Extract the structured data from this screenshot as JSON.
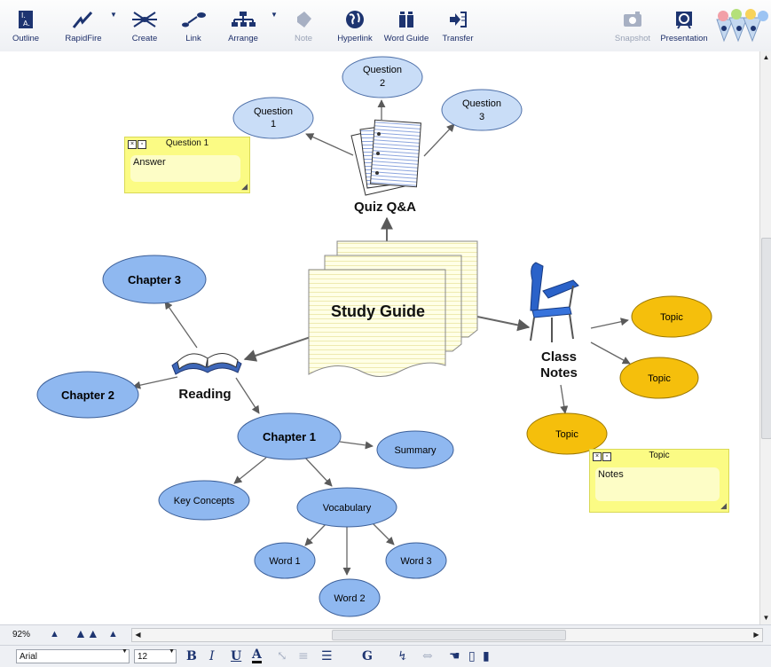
{
  "toolbar": {
    "outline": "Outline",
    "rapidfire": "RapidFire",
    "create": "Create",
    "link": "Link",
    "arrange": "Arrange",
    "note": "Note",
    "hyperlink": "Hyperlink",
    "word_guide": "Word Guide",
    "transfer": "Transfer",
    "snapshot": "Snapshot",
    "presentation": "Presentation"
  },
  "diagram": {
    "study_guide": "Study Guide",
    "quiz": "Quiz Q&A",
    "question1": [
      "Question",
      "1"
    ],
    "question2": [
      "Question",
      "2"
    ],
    "question3": [
      "Question",
      "3"
    ],
    "reading": "Reading",
    "chapter1": "Chapter 1",
    "chapter2": "Chapter 2",
    "chapter3": "Chapter 3",
    "summary": "Summary",
    "key_concepts": "Key Concepts",
    "vocabulary": "Vocabulary",
    "word1": "Word 1",
    "word2": "Word 2",
    "word3": "Word 3",
    "class_notes": [
      "Class",
      "Notes"
    ],
    "topic1": "Topic",
    "topic2": "Topic",
    "topic3": "Topic"
  },
  "notes": {
    "q1_title": "Question 1",
    "q1_body": "Answer",
    "topic_title": "Topic",
    "topic_body": "Notes"
  },
  "zoom": "92%",
  "format": {
    "font": "Arial",
    "size": "12",
    "bold": "B",
    "italic": "I",
    "underline": "U",
    "color": "A"
  },
  "colors": {
    "blue_node": "#8fb8f0",
    "light_node": "#c9ddf7",
    "topic_node": "#f5bf0c",
    "note": "#fbfb84",
    "link": "#666666"
  }
}
